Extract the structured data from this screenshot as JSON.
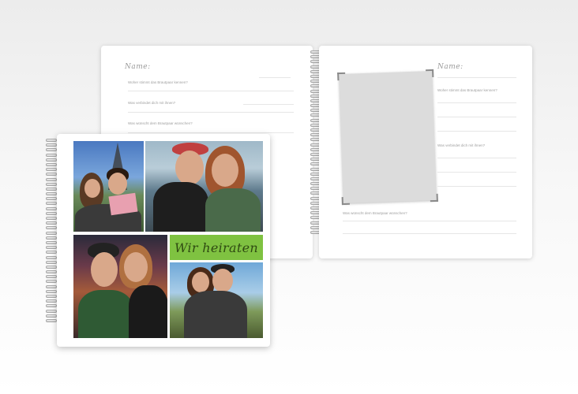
{
  "left_page": {
    "name_label": "Name:",
    "prompts": [
      "Woher stimmt das Brautpaar kennen?",
      "Was verbindet dich mit ihnen?",
      "Was wünscht dem Brautpaar wünschen?"
    ]
  },
  "right_page": {
    "name_label": "Name:",
    "prompts": [
      "Woher stimmt das Brautpaar kennen?",
      "Was verbindet dich mit ihnen?",
      "Was wünscht dem Brautpaar wünschen?"
    ]
  },
  "cover": {
    "banner_text": "Wir heiraten",
    "banner_color": "#7fc241"
  }
}
